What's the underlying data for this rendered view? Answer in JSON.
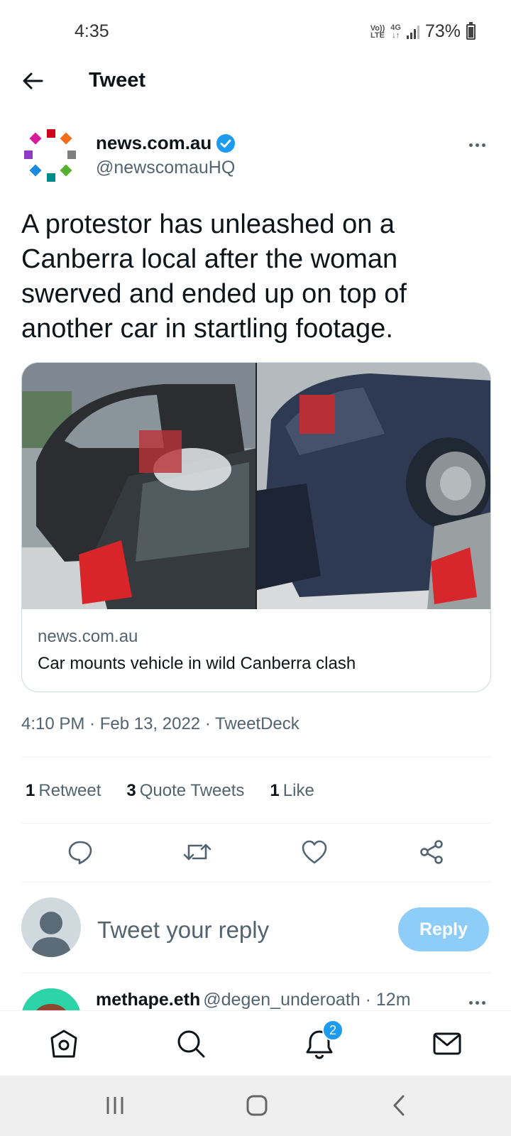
{
  "status_bar": {
    "time": "4:35",
    "volte_top": "Vo))",
    "volte_bottom": "LTE",
    "network": "4G",
    "battery": "73%"
  },
  "header": {
    "title": "Tweet",
    "back_icon": "arrow-left-icon"
  },
  "tweet": {
    "author_name": "news.com.au",
    "author_handle": "@newscomauHQ",
    "verified": true,
    "text": "A protestor has unleashed on a Canberra local after the woman swerved and ended up on top of another car in startling footage.",
    "card": {
      "domain": "news.com.au",
      "title": "Car mounts vehicle in wild Canberra clash"
    },
    "meta": "4:10 PM · Feb 13, 2022 · TweetDeck",
    "stats": [
      {
        "count": "1",
        "label": "Retweet"
      },
      {
        "count": "3",
        "label": "Quote Tweets"
      },
      {
        "count": "1",
        "label": "Like"
      }
    ]
  },
  "actions": [
    "reply-icon",
    "retweet-icon",
    "like-icon",
    "share-icon"
  ],
  "composer": {
    "placeholder": "Tweet your reply",
    "reply_label": "Reply"
  },
  "next_reply": {
    "name": "methape.eth",
    "handle_time": "@degen_underoath · 12m"
  },
  "bottom_nav": {
    "notification_count": "2",
    "icons": [
      "home-icon",
      "search-icon",
      "notifications-icon",
      "messages-icon"
    ]
  },
  "colors": {
    "accent": "#1d9bf0",
    "reply_button_disabled": "#8ecdf8",
    "secondary_text": "#536471"
  }
}
